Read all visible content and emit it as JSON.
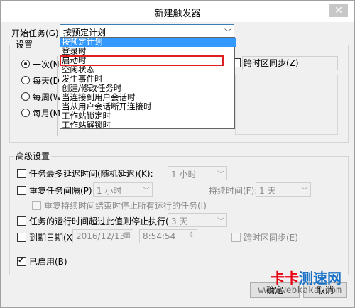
{
  "window": {
    "title": "新建触发器",
    "close_icon": "close-icon"
  },
  "begin_task": {
    "label": "开始任务(G):",
    "value": "按预定计划"
  },
  "settings_group": {
    "title": "设置",
    "radios": [
      {
        "label": "一次(N)",
        "selected": true
      },
      {
        "label": "每天(D)",
        "selected": false
      },
      {
        "label": "每周(W)",
        "selected": false
      },
      {
        "label": "每月(M)",
        "selected": false
      }
    ],
    "sync_timezone": "跨时区同步(Z)"
  },
  "dropdown": {
    "items": [
      "按预定计划",
      "登录时",
      "启动时",
      "空闲状态",
      "发生事件时",
      "创建/修改任务时",
      "当连接到用户会话时",
      "当从用户会话断开连接时",
      "工作站锁定时",
      "工作站解锁时"
    ],
    "selected_index": 0,
    "highlighted_index": 2
  },
  "advanced": {
    "title": "高级设置",
    "delay": {
      "label": "任务最多延迟时间(随机延迟)(K):",
      "value": "1 小时"
    },
    "repeat": {
      "label": "重复任务间隔(P):",
      "value": "1 小时",
      "duration_label": "持续时间(F):",
      "duration_value": "1 天"
    },
    "stop_repeat": "重复持续时间结束时停止所有运行的任务(I)",
    "stop_longer": {
      "label": "任务的运行时间超过此值则停止执行(L):",
      "value": "3 天"
    },
    "expire": {
      "label": "到期日期(X):",
      "date": "2016/12/13",
      "time": "8:54:54",
      "sync": "跨时区同步(E)"
    },
    "enabled": {
      "label": "已启用(B)",
      "checked": true
    }
  },
  "buttons": {
    "ok": "确定",
    "cancel": "取消"
  },
  "watermark": {
    "brand": "卡卡测速网",
    "url": "www.webkaka.com"
  },
  "colors": {
    "selection": "#3399ff",
    "highlight_box": "#e02020",
    "wm_red": "#e60012",
    "wm_blue": "#1a73c7"
  }
}
